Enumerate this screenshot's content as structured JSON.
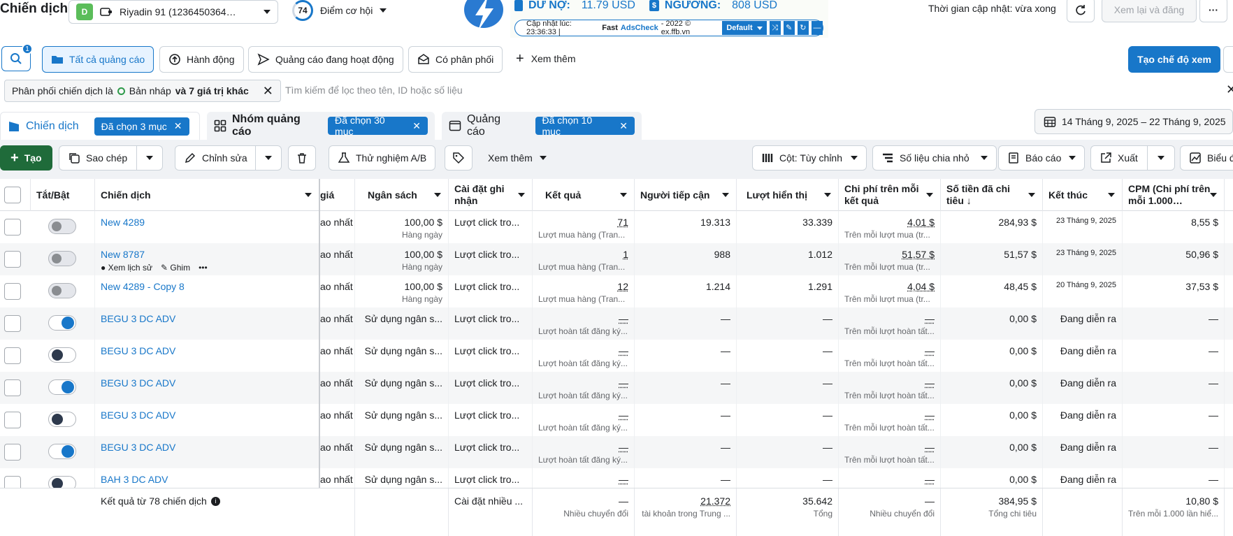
{
  "header": {
    "title": "Chiến dịch",
    "account_letter": "D",
    "account_name": "Riyadin 91 (1236450364…",
    "opportunity_score": "74",
    "opportunity_label": "Điểm cơ hội",
    "update_time": "Thời gian cập nhật: vừa xong",
    "review_button": "Xem lại và đăng",
    "more": "···"
  },
  "extension": {
    "debt_label": "DƯ NỢ:",
    "debt_value": "11.79 USD",
    "threshold_label": "NGƯỠNG:",
    "threshold_value": "808 USD",
    "updated_prefix": "Cập nhật lúc: 23:36:33 |",
    "brand_fast": "Fast",
    "brand_name": "AdsCheck",
    "brand_suffix": "- 2022 © ex.ffb.vn",
    "mode": "Default"
  },
  "filters": {
    "search_badge": "1",
    "all_ads": "Tất cả quảng cáo",
    "actions": "Hành động",
    "active_ads": "Quảng cáo đang hoạt động",
    "has_delivery": "Có phân phối",
    "see_more": "Xem thêm",
    "create_view": "Tạo chế độ xem",
    "filter_prefix": "Phân phối chiến dịch là",
    "filter_value": "Bản nháp",
    "filter_more": "và 7 giá trị khác",
    "search_placeholder": "Tìm kiếm để lọc theo tên, ID hoặc số liệu"
  },
  "levels": {
    "campaign": "Chiến dịch",
    "campaign_chip": "Đã chọn 3 mục",
    "adset": "Nhóm quảng cáo",
    "adset_chip": "Đã chọn 30 mục",
    "ad": "Quảng cáo",
    "ad_chip": "Đã chọn 10 mục",
    "date_range": "14 Tháng 9, 2025 – 22 Tháng 9, 2025"
  },
  "toolbar": {
    "create": "Tạo",
    "duplicate": "Sao chép",
    "edit": "Chỉnh sửa",
    "ab_test": "Thử nghiệm A/B",
    "more": "Xem thêm",
    "columns": "Cột: Tùy chỉnh",
    "breakdown": "Số liệu chia nhỏ",
    "reports": "Báo cáo",
    "export": "Xuất",
    "charts": "Biểu đ"
  },
  "columns": {
    "toggle": "Tắt/Bật",
    "campaign": "Chiến dịch",
    "bid": "giá",
    "budget": "Ngân sách",
    "attribution": "Cài đặt ghi nhận",
    "results": "Kết quả",
    "reach": "Người tiếp cận",
    "impressions": "Lượt hiển thị",
    "cost_per_result": "Chi phí trên mỗi kết quả",
    "amount_spent": "Số tiền đã chi tiêu ↓",
    "ends": "Kết thúc",
    "cpm": "CPM (Chi phí trên mỗi 1.000…"
  },
  "row_actions": {
    "history": "Xem lịch sử",
    "pin": "Ghim",
    "more": "•••"
  },
  "rows": [
    {
      "name": "New 4289",
      "bid": "ao nhất",
      "budget": "100,00 $",
      "budget_sub": "Hàng ngày",
      "attr": "Lượt click tro...",
      "result": "71",
      "result_sub": "Lượt mua hàng (Tran...",
      "reach": "19.313",
      "impr": "33.339",
      "cpr": "4,01 $",
      "cpr_sub": "Trên mỗi lượt mua (tr...",
      "spent": "284,93 $",
      "ends": "23 Tháng 9, 2025",
      "cpm": "8,55 $",
      "toggle": "off"
    },
    {
      "name": "New 8787",
      "bid": "ao nhất",
      "budget": "100,00 $",
      "budget_sub": "Hàng ngày",
      "attr": "Lượt click tro...",
      "result": "1",
      "result_sub": "Lượt mua hàng (Tran...",
      "reach": "988",
      "impr": "1.012",
      "cpr": "51,57 $",
      "cpr_sub": "Trên mỗi lượt mua (tr...",
      "spent": "51,57 $",
      "ends": "23 Tháng 9, 2025",
      "cpm": "50,96 $",
      "toggle": "off"
    },
    {
      "name": "New 4289 - Copy 8",
      "bid": "ao nhất",
      "budget": "100,00 $",
      "budget_sub": "Hàng ngày",
      "attr": "Lượt click tro...",
      "result": "12",
      "result_sub": "Lượt mua hàng (Tran...",
      "reach": "1.214",
      "impr": "1.291",
      "cpr": "4,04 $",
      "cpr_sub": "Trên mỗi lượt mua (tr...",
      "spent": "48,45 $",
      "ends": "20 Tháng 9, 2025",
      "cpm": "37,53 $",
      "toggle": "off"
    },
    {
      "name": "BEGU 3 DC ADV",
      "bid": "ao nhất",
      "budget": "Sử dụng ngân s...",
      "budget_sub": "",
      "attr": "Lượt click tro...",
      "result": "—",
      "result_sub": "Lượt hoàn tất đăng ký...",
      "reach": "—",
      "impr": "—",
      "cpr": "—",
      "cpr_sub": "Trên mỗi lượt hoàn tất...",
      "spent": "0,00 $",
      "ends": "Đang diễn ra",
      "cpm": "—",
      "toggle": "on"
    },
    {
      "name": "BEGU 3 DC ADV",
      "bid": "ao nhất",
      "budget": "Sử dụng ngân s...",
      "budget_sub": "",
      "attr": "Lượt click tro...",
      "result": "—",
      "result_sub": "Lượt hoàn tất đăng ký...",
      "reach": "—",
      "impr": "—",
      "cpr": "—",
      "cpr_sub": "Trên mỗi lượt hoàn tất...",
      "spent": "0,00 $",
      "ends": "Đang diễn ra",
      "cpm": "—",
      "toggle": "dark"
    },
    {
      "name": "BEGU 3 DC ADV",
      "bid": "ao nhất",
      "budget": "Sử dụng ngân s...",
      "budget_sub": "",
      "attr": "Lượt click tro...",
      "result": "—",
      "result_sub": "Lượt hoàn tất đăng ký...",
      "reach": "—",
      "impr": "—",
      "cpr": "—",
      "cpr_sub": "Trên mỗi lượt hoàn tất...",
      "spent": "0,00 $",
      "ends": "Đang diễn ra",
      "cpm": "—",
      "toggle": "on"
    },
    {
      "name": "BEGU 3 DC ADV",
      "bid": "ao nhất",
      "budget": "Sử dụng ngân s...",
      "budget_sub": "",
      "attr": "Lượt click tro...",
      "result": "—",
      "result_sub": "Lượt hoàn tất đăng ký...",
      "reach": "—",
      "impr": "—",
      "cpr": "—",
      "cpr_sub": "Trên mỗi lượt hoàn tất...",
      "spent": "0,00 $",
      "ends": "Đang diễn ra",
      "cpm": "—",
      "toggle": "dark"
    },
    {
      "name": "BEGU 3 DC ADV",
      "bid": "ao nhất",
      "budget": "Sử dụng ngân s...",
      "budget_sub": "",
      "attr": "Lượt click tro...",
      "result": "—",
      "result_sub": "Lượt hoàn tất đăng ký...",
      "reach": "—",
      "impr": "—",
      "cpr": "—",
      "cpr_sub": "Trên mỗi lượt hoàn tất...",
      "spent": "0,00 $",
      "ends": "Đang diễn ra",
      "cpm": "—",
      "toggle": "on"
    },
    {
      "name": "BAH 3 DC ADV",
      "bid": "ao nhất",
      "budget": "Sử dụng ngân s...",
      "budget_sub": "",
      "attr": "Lượt click tro...",
      "result": "—",
      "result_sub": "",
      "reach": "—",
      "impr": "—",
      "cpr": "—",
      "cpr_sub": "",
      "spent": "0,00 $",
      "ends": "Đang diễn ra",
      "cpm": "—",
      "toggle": "dark"
    }
  ],
  "footer": {
    "summary": "Kết quả từ 78 chiến dịch",
    "attr": "Cài đặt nhiều ...",
    "result": "—",
    "result_sub": "Nhiều chuyển đổi",
    "reach": "21.372",
    "reach_sub": "tài khoản trong Trung ...",
    "impr": "35.642",
    "impr_sub": "Tổng",
    "cpr": "—",
    "cpr_sub": "Nhiều chuyển đổi",
    "spent": "384,95 $",
    "spent_sub": "Tổng chi tiêu",
    "cpm": "10,80 $",
    "cpm_sub": "Trên mỗi 1.000 lần hiể..."
  }
}
